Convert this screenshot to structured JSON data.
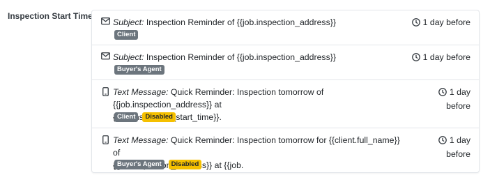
{
  "section": {
    "label": "Inspection Start Time"
  },
  "reminders": [
    {
      "type": "Subject:",
      "message": " Inspection Reminder of {{job.inspection_address}}",
      "badges": [
        "Client"
      ],
      "timing": "1 day before"
    },
    {
      "type": "Subject:",
      "message": " Inspection Reminder of {{job.inspection_address}}",
      "badges": [
        "Buyer's Agent"
      ],
      "timing": "1 day before"
    },
    {
      "type": "Text Message:",
      "message_line1": " Quick Reminder: Inspection tomorrow of {{job.inspection_address}} at",
      "message_line2": "{{job.inspection_start_time}}.",
      "badges": [
        "Client",
        "Disabled"
      ],
      "timing_line1": "1 day",
      "timing_line2": "before"
    },
    {
      "type": "Text Message:",
      "message_line1": " Quick Reminder: Inspection tomorrow for {{client.full_name}} of",
      "message_line2": "{{job.inspection_address}} at {{job.",
      "badges": [
        "Buyer's Agent",
        "Disabled"
      ],
      "timing_line1": "1 day",
      "timing_line2": "before"
    }
  ]
}
